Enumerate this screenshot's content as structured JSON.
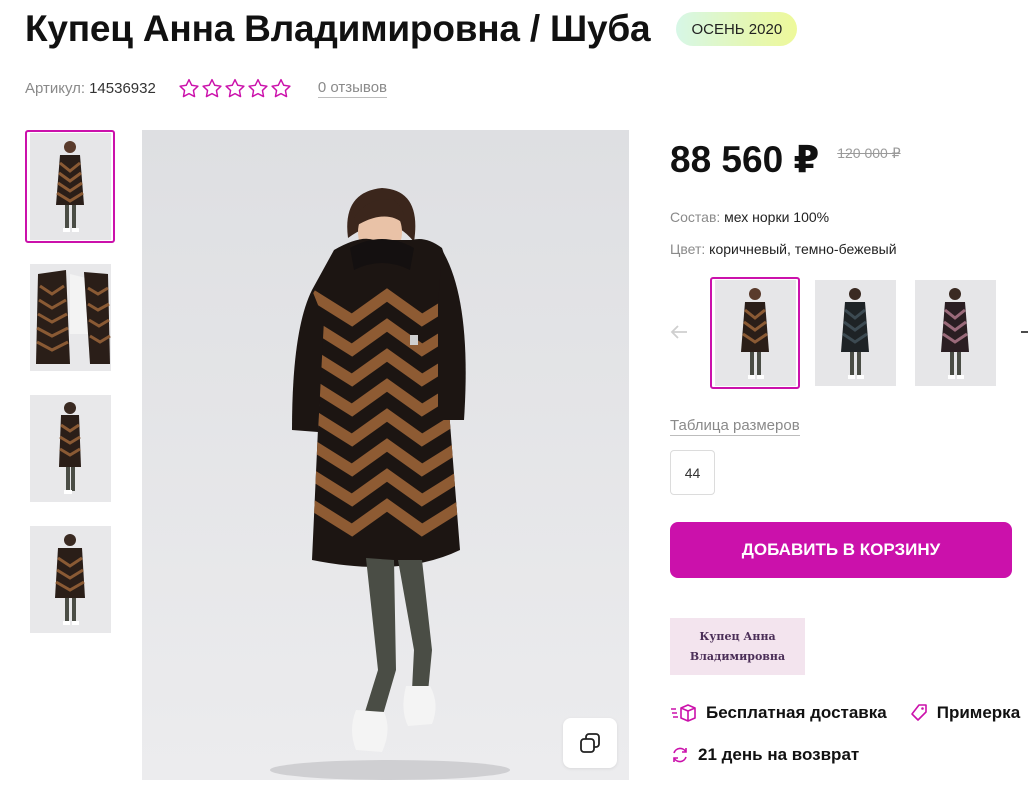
{
  "product": {
    "title": "Купец Анна Владимировна / Шуба",
    "season_badge": "ОСЕНЬ 2020",
    "article_label": "Артикул:",
    "article_value": "14536932",
    "rating_stars": 0,
    "reviews_text": "0 отзывов"
  },
  "gallery": {
    "thumbnails": [
      "photo-front",
      "photo-open-lining",
      "photo-side",
      "photo-back"
    ],
    "active_index": 0,
    "main_photo": "model-in-brown-chevron-mink-coat"
  },
  "price": {
    "current": "88 560 ₽",
    "old": "120 000 ₽"
  },
  "attributes": {
    "composition_label": "Состав:",
    "composition_value": "мех норки 100%",
    "color_label": "Цвет:",
    "color_value": "коричневый, темно-бежевый"
  },
  "color_options": [
    "brown-chevron",
    "dark-chevron",
    "mauve-chevron"
  ],
  "sizes": {
    "table_link": "Таблица размеров",
    "options": [
      "44"
    ]
  },
  "cart": {
    "add_label": "ДОБАВИТЬ В КОРЗИНУ"
  },
  "brand": {
    "logo_line1": "Купец Анна",
    "logo_line2": "Владимировна"
  },
  "benefits": {
    "delivery": "Бесплатная доставка",
    "fitting": "Примерка",
    "return": "21 день на возврат"
  },
  "colors": {
    "accent": "#cb11ab",
    "badge_from": "#d7f7e7",
    "badge_to": "#eef99a",
    "muted": "#8a8a8a"
  }
}
